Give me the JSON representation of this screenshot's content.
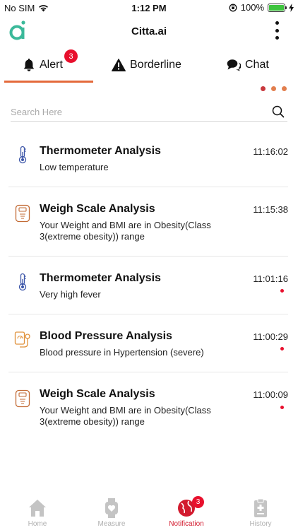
{
  "status_bar": {
    "carrier": "No SIM",
    "time": "1:12 PM",
    "battery": "100%"
  },
  "header": {
    "title": "Citta.ai"
  },
  "tabs": [
    {
      "label": "Alert",
      "badge": "3",
      "active": true
    },
    {
      "label": "Borderline"
    },
    {
      "label": "Chat"
    }
  ],
  "page_indicator_colors": [
    "#c8383d",
    "#e27f4e",
    "#e27f4e"
  ],
  "search": {
    "placeholder": "Search Here",
    "value": ""
  },
  "notifications": [
    {
      "icon": "thermometer-icon",
      "title": "Thermometer Analysis",
      "time": "11:16:02",
      "description": "Low temperature",
      "unread": false
    },
    {
      "icon": "weigh-scale-icon",
      "title": "Weigh Scale Analysis",
      "time": "11:15:38",
      "description": "Your Weight and BMI are in Obesity(Class 3(extreme obesity)) range",
      "unread": false
    },
    {
      "icon": "thermometer-icon",
      "title": "Thermometer Analysis",
      "time": "11:01:16",
      "description": "Very high fever",
      "unread": true
    },
    {
      "icon": "blood-pressure-icon",
      "title": "Blood Pressure Analysis",
      "time": "11:00:29",
      "description": "Blood pressure in Hypertension (severe)",
      "unread": true
    },
    {
      "icon": "weigh-scale-icon",
      "title": "Weigh Scale Analysis",
      "time": "11:00:09",
      "description": "Your Weight and BMI are in Obesity(Class 3(extreme obesity)) range",
      "unread": true
    }
  ],
  "bottom_nav": [
    {
      "label": "Home",
      "icon": "home-icon"
    },
    {
      "label": "Measure",
      "icon": "watch-heart-icon"
    },
    {
      "label": "Notification",
      "icon": "globe-notification-icon",
      "badge": "3",
      "active": true
    },
    {
      "label": "History",
      "icon": "clipboard-icon"
    }
  ],
  "colors": {
    "accent": "#e46a3b",
    "badge": "#e8102d",
    "active_nav": "#d21a2e",
    "logo": "#3bb99a"
  }
}
